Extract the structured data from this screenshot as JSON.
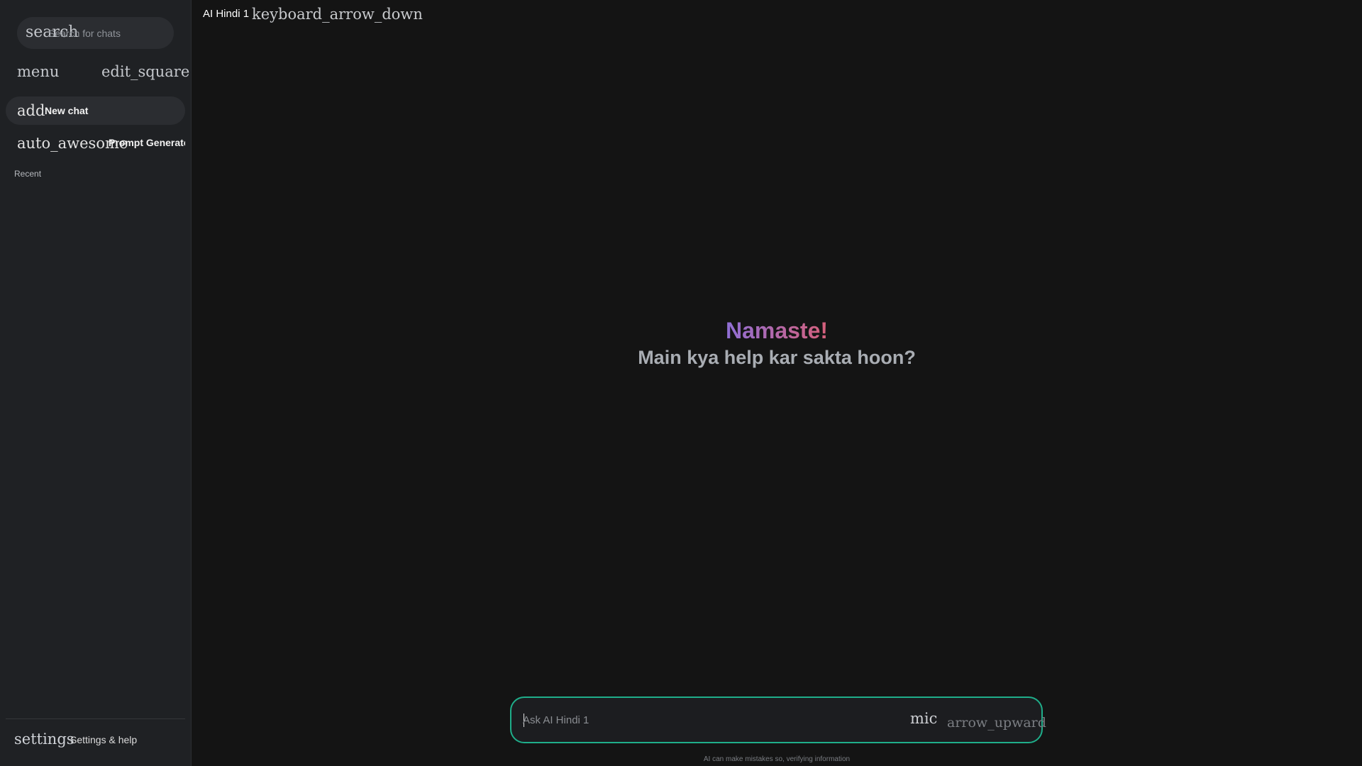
{
  "sidebar": {
    "search": {
      "icon": "search",
      "placeholder": "Search for chats"
    },
    "menu_icon": "menu",
    "edit_icon": "edit_square",
    "new_chat": {
      "icon": "add",
      "label": "New chat"
    },
    "prompt_generator": {
      "icon": "auto_awesome",
      "label": "Prompt Generator"
    },
    "recent_label": "Recent",
    "settings": {
      "icon": "settings",
      "label": "Settings & help"
    }
  },
  "header": {
    "model_name": "AI Hindi 1",
    "dropdown_icon": "keyboard_arrow_down"
  },
  "greeting": {
    "hello": "Namaste!",
    "subtitle": "Main kya help kar sakta hoon?"
  },
  "composer": {
    "placeholder": "Ask AI Hindi 1",
    "mic_icon": "mic",
    "send_icon": "arrow_upward"
  },
  "footer": {
    "disclaimer": "AI can make mistakes so, verifying information"
  },
  "colors": {
    "accent_border": "#1fae8a",
    "greeting_gradient_start": "#8f6fd6",
    "greeting_gradient_end": "#d6607a"
  }
}
